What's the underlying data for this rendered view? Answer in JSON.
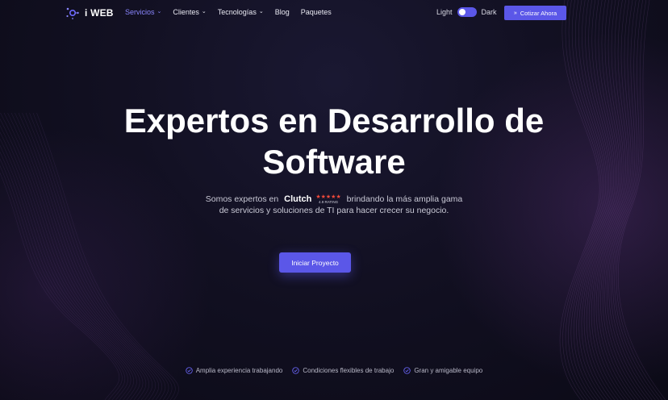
{
  "brand": {
    "name": "i WEB",
    "accent": "#5b57e8"
  },
  "nav": {
    "items": [
      {
        "label": "Servicios",
        "dropdown": true,
        "active": true
      },
      {
        "label": "Clientes",
        "dropdown": true,
        "active": false
      },
      {
        "label": "Tecnologías",
        "dropdown": true,
        "active": false
      },
      {
        "label": "Blog",
        "dropdown": false,
        "active": false
      },
      {
        "label": "Paquetes",
        "dropdown": false,
        "active": false
      }
    ],
    "chevron_icon": "chevron-down-icon"
  },
  "theme_toggle": {
    "left_label": "Light",
    "right_label": "Dark",
    "state": "light"
  },
  "cta_top": {
    "label": "Cotizar Ahora",
    "icon": "double-chevron-right-icon"
  },
  "hero": {
    "title_line1": "Expertos en Desarrollo de",
    "title_line2": "Software",
    "sub_before": "Somos expertos en",
    "clutch_name": "Clutch",
    "clutch_stars": "★★★★★",
    "clutch_rating": "4.9 RATING",
    "sub_after": "brindando la más amplia gama de servicios y soluciones de TI para hacer crecer su negocio.",
    "button_label": "Iniciar Proyecto"
  },
  "features": [
    {
      "label": "Amplia experiencia trabajando",
      "icon": "check-circle-icon"
    },
    {
      "label": "Condiciones flexibles de trabajo",
      "icon": "check-circle-icon"
    },
    {
      "label": "Gran y amigable equipo",
      "icon": "check-circle-icon"
    }
  ]
}
